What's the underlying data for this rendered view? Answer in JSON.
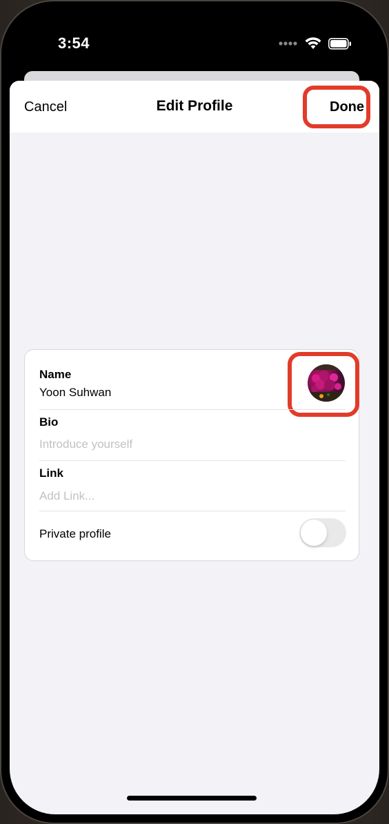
{
  "status_bar": {
    "time": "3:54",
    "signal_icon": "cellular-dots-icon",
    "wifi_icon": "wifi-icon",
    "battery_icon": "battery-icon"
  },
  "nav": {
    "cancel_label": "Cancel",
    "title": "Edit Profile",
    "done_label": "Done"
  },
  "form": {
    "name_label": "Name",
    "name_value": "Yoon Suhwan",
    "bio_label": "Bio",
    "bio_placeholder": "Introduce yourself",
    "link_label": "Link",
    "link_placeholder": "Add Link...",
    "private_label": "Private profile",
    "private_enabled": false,
    "avatar_icon": "profile-photo-avatar"
  },
  "highlight_color": "#e23b2a"
}
